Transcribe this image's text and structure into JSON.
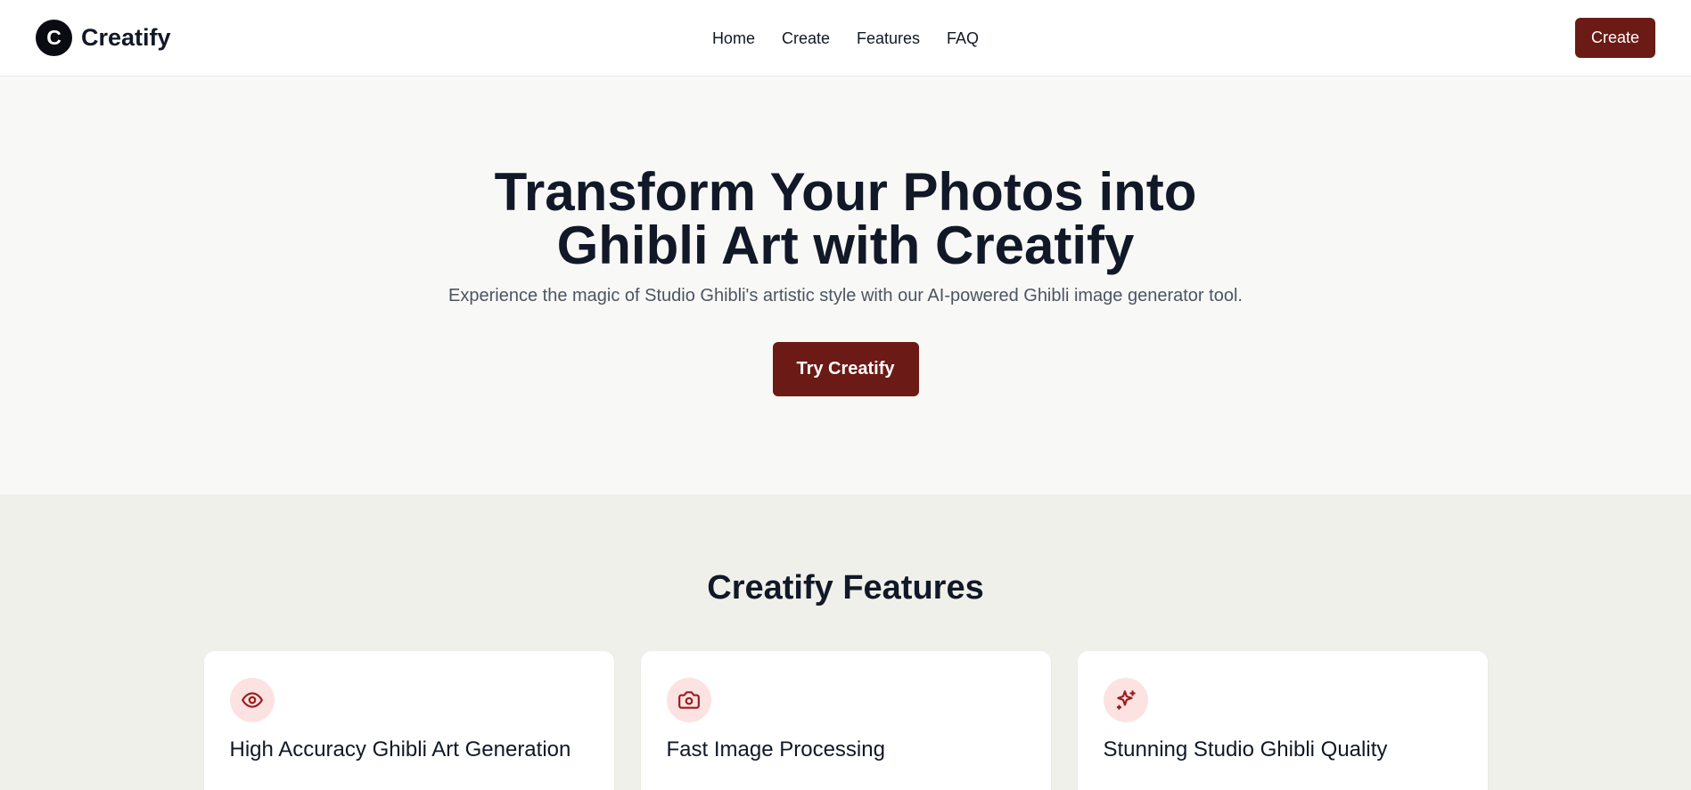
{
  "brand": {
    "logo_letter": "C",
    "name": "Creatify"
  },
  "nav": {
    "items": [
      {
        "label": "Home"
      },
      {
        "label": "Create"
      },
      {
        "label": "Features"
      },
      {
        "label": "FAQ"
      }
    ],
    "cta_label": "Create"
  },
  "hero": {
    "title": "Transform Your Photos into Ghibli Art with Creatify",
    "subtitle": "Experience the magic of Studio Ghibli's artistic style with our AI-powered Ghibli image generator tool.",
    "button_label": "Try Creatify"
  },
  "features": {
    "title": "Creatify Features",
    "cards": [
      {
        "icon": "eye-icon",
        "title": "High Accuracy Ghibli Art Generation"
      },
      {
        "icon": "camera-icon",
        "title": "Fast Image Processing"
      },
      {
        "icon": "sparkles-icon",
        "title": "Stunning Studio Ghibli Quality"
      }
    ]
  },
  "colors": {
    "accent": "#6b1a15",
    "icon_color": "#9b1c1c",
    "icon_bg": "#fde2e2",
    "hero_bg": "#f8f8f6",
    "features_bg": "#f0f0eb"
  }
}
